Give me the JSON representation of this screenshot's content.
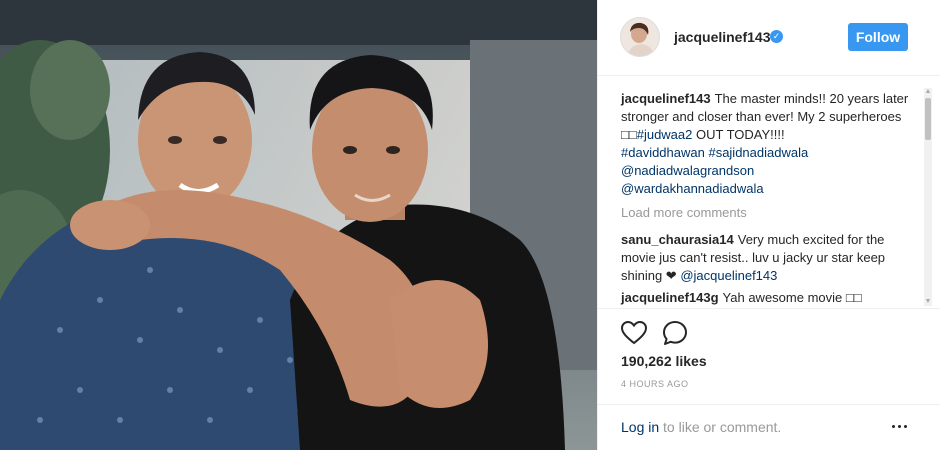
{
  "post": {
    "username": "jacquelinef143",
    "follow_label": "Follow",
    "caption": {
      "author": "jacquelinef143",
      "text": "The master minds!! 20 years later stronger and closer than ever! My 2 superheroes □□",
      "hashtags_line1": "#judwaa2",
      "text_after": " OUT TODAY!!!!",
      "hashtags_line2": "#daviddhawan #sajidnadiadwala",
      "mention1": "@nadiadwalagrandson",
      "mention2": "@wardakhannadiadwala"
    },
    "load_more_label": "Load more comments",
    "comments": [
      {
        "author": "sanu_chaurasia14",
        "text": "Very much excited for the movie jus can't resist.. luv u jacky ur star keep shining ❤",
        "mention": "@jacquelinef143"
      },
      {
        "author": "jacquelinef143g",
        "text": "Yah awesome movie □□"
      }
    ],
    "likes": "190,262 likes",
    "timestamp": "4 HOURS AGO",
    "login_link": "Log in",
    "login_suffix": " to like or comment."
  },
  "icons": {
    "like": "heart-outline-icon",
    "comment": "speech-bubble-icon",
    "more": "ellipsis-icon",
    "verified": "verified-badge-icon"
  },
  "colors": {
    "accent": "#3897f0",
    "link": "#003569",
    "muted": "#999999",
    "text": "#262626"
  }
}
